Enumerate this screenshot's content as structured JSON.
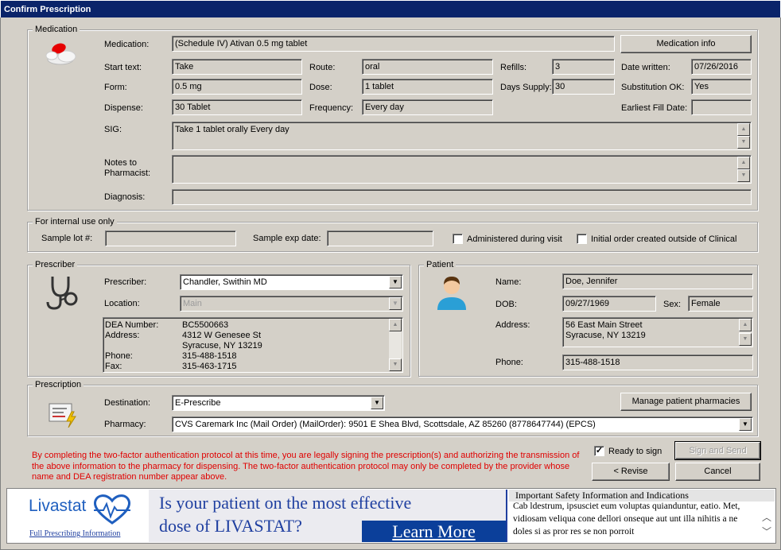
{
  "window": {
    "title": "Confirm Prescription"
  },
  "medication": {
    "group_label": "Medication",
    "medication_label": "Medication:",
    "medication_value": "(Schedule IV) Ativan 0.5 mg tablet",
    "info_button": "Medication info",
    "start_text_label": "Start text:",
    "start_text_value": "Take",
    "route_label": "Route:",
    "route_value": "oral",
    "refills_label": "Refills:",
    "refills_value": "3",
    "date_written_label": "Date written:",
    "date_written_value": "07/26/2016",
    "form_label": "Form:",
    "form_value": "0.5 mg",
    "dose_label": "Dose:",
    "dose_value": "1 tablet",
    "days_supply_label": "Days Supply:",
    "days_supply_value": "30",
    "substitution_label": "Substitution OK:",
    "substitution_value": "Yes",
    "dispense_label": "Dispense:",
    "dispense_value": "30 Tablet",
    "frequency_label": "Frequency:",
    "frequency_value": "Every day",
    "earliest_fill_label": "Earliest Fill Date:",
    "earliest_fill_value": "",
    "sig_label": "SIG:",
    "sig_value": "Take 1 tablet orally Every day",
    "notes_label": "Notes to Pharmacist:",
    "notes_value": "",
    "diagnosis_label": "Diagnosis:",
    "diagnosis_value": ""
  },
  "internal": {
    "group_label": "For internal use only",
    "sample_lot_label": "Sample lot #:",
    "sample_lot_value": "",
    "sample_exp_label": "Sample exp date:",
    "sample_exp_value": "",
    "administered_label": "Administered during visit",
    "initial_order_label": "Initial order created outside of Clinical"
  },
  "prescriber": {
    "group_label": "Prescriber",
    "prescriber_label": "Prescriber:",
    "prescriber_value": "Chandler, Swithin MD",
    "location_label": "Location:",
    "location_value": "Main",
    "dea_label": "DEA Number:",
    "dea_value": "BC5500663",
    "address_label": "Address:",
    "address_line1": "4312 W Genesee St",
    "address_line2": "Syracuse, NY 13219",
    "phone_label": "Phone:",
    "phone_value": "315-488-1518",
    "fax_label": "Fax:",
    "fax_value": "315-463-1715"
  },
  "patient": {
    "group_label": "Patient",
    "name_label": "Name:",
    "name_value": "Doe, Jennifer",
    "dob_label": "DOB:",
    "dob_value": "09/27/1969",
    "sex_label": "Sex:",
    "sex_value": "Female",
    "address_label": "Address:",
    "address_line1": "56 East Main Street",
    "address_line2": "Syracuse, NY 13219",
    "phone_label": "Phone:",
    "phone_value": "315-488-1518"
  },
  "prescription": {
    "group_label": "Prescription",
    "destination_label": "Destination:",
    "destination_value": "E-Prescribe",
    "pharmacy_label": "Pharmacy:",
    "pharmacy_value": "CVS Caremark Inc (Mail Order) (MailOrder):  9501 E Shea Blvd, Scottsdale, AZ 85260 (8778647744) (EPCS)",
    "manage_button": "Manage patient pharmacies"
  },
  "footer": {
    "legal_text": "By completing the two-factor authentication protocol at this time, you are legally signing the prescription(s) and authorizing the transmission of the above information to the pharmacy for dispensing.  The two-factor authentication protocol may only be completed by the provider whose name and DEA registration number appear above.",
    "ready_label": "Ready to sign",
    "ready_checked": "✓",
    "sign_send_button": "Sign and Send",
    "revise_button": "< Revise",
    "cancel_button": "Cancel"
  },
  "ad": {
    "brand": "Livastat",
    "prescribing_link": "Full Prescribing Information",
    "headline_line1": "Is your patient on the most effective",
    "headline_line2": "dose of LIVASTAT?",
    "cta": "Learn More",
    "safety_title": "Important Safety Information and Indications",
    "safety_text": "Cab ldestrum, ipsusciet eum voluptas quianduntur, eatio. Met, vidiosam veliqua cone dellori onseque aut unt illa nihitis a ne doles si as pror res se non porroit"
  },
  "colors": {
    "titlebar": "#0a246a",
    "legal_red": "#e00000",
    "ad_blue": "#1f3fa0",
    "cta_bg": "#0b3f9a"
  }
}
